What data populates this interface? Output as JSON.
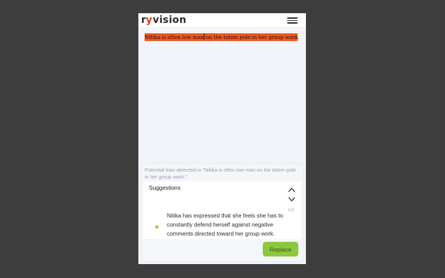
{
  "app": {
    "logo_r": "r",
    "logo_v": "y",
    "logo_rest": "vision"
  },
  "document": {
    "text_before_caret": "Nitika is often low man",
    "text_after_caret": " on the totem pole in her group work",
    "trailing": "."
  },
  "panel": {
    "detected_message": "Potential bias detected in \"Nitika is often low man on the totem pole in her group work.\"",
    "suggestions_title": "Suggestions",
    "counter": "1/3",
    "suggestion_text": "Nitika has expressed that she feels she has to constantly defend herself against negative comments directed toward her group work.",
    "replace_label": "Replace"
  },
  "colors": {
    "highlight": "#f0561e",
    "accent_green": "#8cc83e",
    "brand_red": "#e23a1c"
  }
}
